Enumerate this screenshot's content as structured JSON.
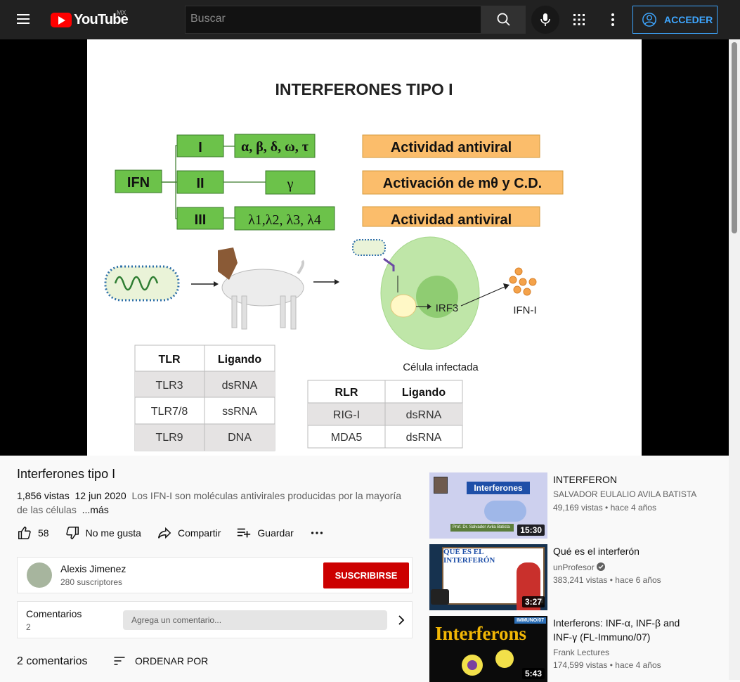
{
  "header": {
    "logo_text": "YouTube",
    "logo_country": "MX",
    "search_placeholder": "Buscar",
    "signin_label": "ACCEDER"
  },
  "slide": {
    "title": "INTERFERONES TIPO I",
    "ifn_label": "IFN",
    "types": [
      {
        "roman": "I",
        "members": "α, β, δ, ω, τ",
        "function": "Actividad antiviral"
      },
      {
        "roman": "II",
        "members": "γ",
        "function": "Activación de mθ y C.D."
      },
      {
        "roman": "III",
        "members": "λ1,λ2, λ3, λ4",
        "function": "Actividad antiviral"
      }
    ],
    "irf3_label": "IRF3",
    "ifn1_label": "IFN-I",
    "cell_label": "Célula infectada",
    "tlr_table": {
      "headers": [
        "TLR",
        "Ligando"
      ],
      "rows": [
        [
          "TLR3",
          "dsRNA"
        ],
        [
          "TLR7/8",
          "ssRNA"
        ],
        [
          "TLR9",
          "DNA"
        ]
      ]
    },
    "rlr_table": {
      "headers": [
        "RLR",
        "Ligando"
      ],
      "rows": [
        [
          "RIG-I",
          "dsRNA"
        ],
        [
          "MDA5",
          "dsRNA"
        ]
      ]
    }
  },
  "video": {
    "title": "Interferones tipo I",
    "views": "1,856 vistas",
    "date": "12 jun 2020",
    "description": "Los IFN-I son moléculas antivirales producidas por la mayoría de las células",
    "more_label": "...más",
    "likes": "58",
    "dislike_label": "No me gusta",
    "share_label": "Compartir",
    "save_label": "Guardar"
  },
  "channel": {
    "name": "Alexis Jimenez",
    "subscribers": "280 suscriptores",
    "subscribe_label": "SUSCRIBIRSE"
  },
  "comments": {
    "title": "Comentarios",
    "count": "2",
    "placeholder": "Agrega un comentario...",
    "total_label": "2 comentarios",
    "sort_label": "ORDENAR POR"
  },
  "recommendations": [
    {
      "title": "INTERFERON",
      "channel": "SALVADOR EULALIO AVILA BATISTA",
      "views": "49,169 vistas",
      "age": "hace 4 años",
      "duration": "15:30",
      "thumb_text": "Interferones",
      "thumb_sub": "Prof. Dr. Salvador Avila Batista"
    },
    {
      "title": "Qué es el interferón",
      "channel": "unProfesor",
      "views": "383,241 vistas",
      "age": "hace 6 años",
      "duration": "3:27",
      "thumb_text": "QUÉ ES EL INTERFERÓN",
      "verified": true
    },
    {
      "title": "Interferons: INF-α, INF-β and INF-γ (FL-Immuno/07)",
      "channel": "Frank Lectures",
      "views": "174,599 vistas",
      "age": "hace 4 años",
      "duration": "5:43",
      "thumb_text": "Interferons",
      "thumb_tag": "IMMUNO/07"
    }
  ]
}
